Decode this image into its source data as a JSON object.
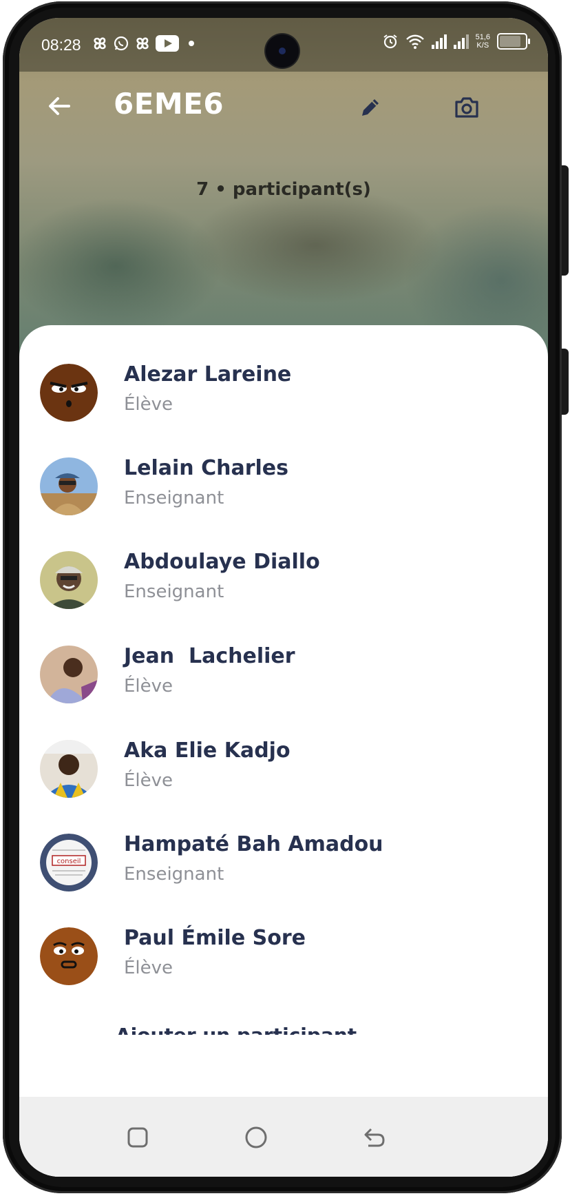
{
  "status_bar": {
    "time": "08:28",
    "net_speed_value": "51,6",
    "net_speed_unit": "K/S"
  },
  "header": {
    "title": "6EME6",
    "participants_label": "7 • participant(s)"
  },
  "colors": {
    "name_text": "#27314f",
    "role_text": "#8e9096",
    "sheet_bg": "#ffffff"
  },
  "participants": [
    {
      "name": "Alezar Lareine",
      "role": "Élève",
      "avatar_icon": "cartoon-face-avatar"
    },
    {
      "name": "Lelain Charles",
      "role": "Enseignant",
      "avatar_icon": "photo-avatar"
    },
    {
      "name": "Abdoulaye Diallo",
      "role": "Enseignant",
      "avatar_icon": "photo-avatar"
    },
    {
      "name": "Jean  Lachelier",
      "role": "Élève",
      "avatar_icon": "photo-avatar"
    },
    {
      "name": "Aka Elie Kadjo",
      "role": "Élève",
      "avatar_icon": "photo-avatar"
    },
    {
      "name": "Hampaté Bah Amadou",
      "role": "Enseignant",
      "avatar_icon": "conseil-badge-avatar"
    },
    {
      "name": "Paul Émile Sore",
      "role": "Élève",
      "avatar_icon": "cartoon-face-avatar"
    }
  ],
  "footer_peek": "Ajouter un participant",
  "icons": {
    "back": "arrow-left-icon",
    "edit": "pencil-icon",
    "camera": "camera-icon",
    "nav_recents": "square-icon",
    "nav_home": "circle-icon",
    "nav_back": "back-arrow-icon"
  }
}
